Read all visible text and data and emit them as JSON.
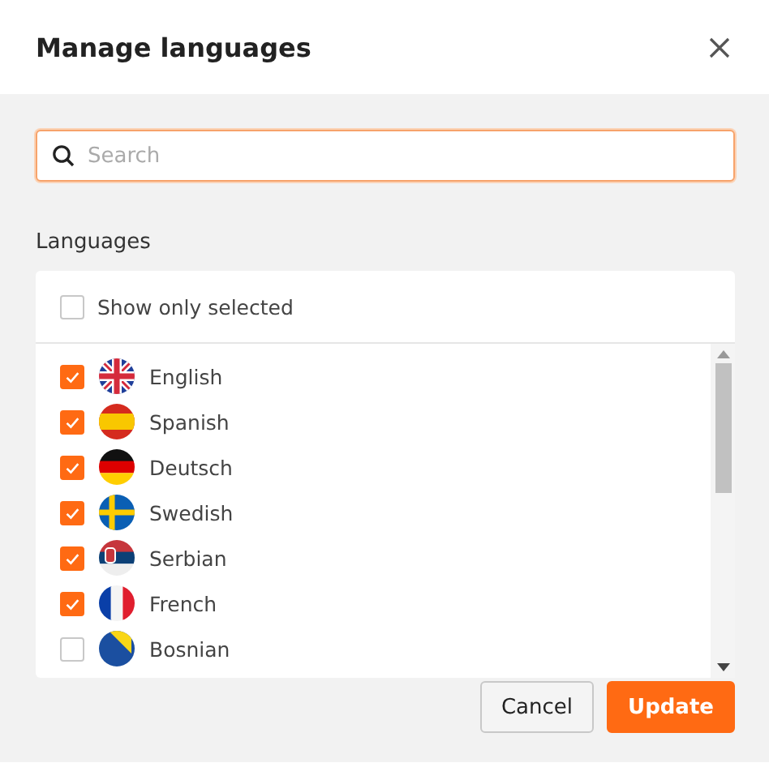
{
  "dialog": {
    "title": "Manage languages"
  },
  "search": {
    "placeholder": "Search"
  },
  "languages_label": "Languages",
  "show_only_selected": {
    "label": "Show only selected",
    "checked": false
  },
  "languages": [
    {
      "name": "English",
      "kind": "gb",
      "checked": true
    },
    {
      "name": "Spanish",
      "kind": "es",
      "checked": true
    },
    {
      "name": "Deutsch",
      "kind": "de",
      "checked": true
    },
    {
      "name": "Swedish",
      "kind": "se",
      "checked": true
    },
    {
      "name": "Serbian",
      "kind": "rs",
      "checked": true
    },
    {
      "name": "French",
      "kind": "fr",
      "checked": true
    },
    {
      "name": "Bosnian",
      "kind": "ba",
      "checked": false
    }
  ],
  "buttons": [
    {
      "label": "Cancel",
      "kind": "secondary"
    },
    {
      "label": "Update",
      "kind": "primary"
    }
  ]
}
